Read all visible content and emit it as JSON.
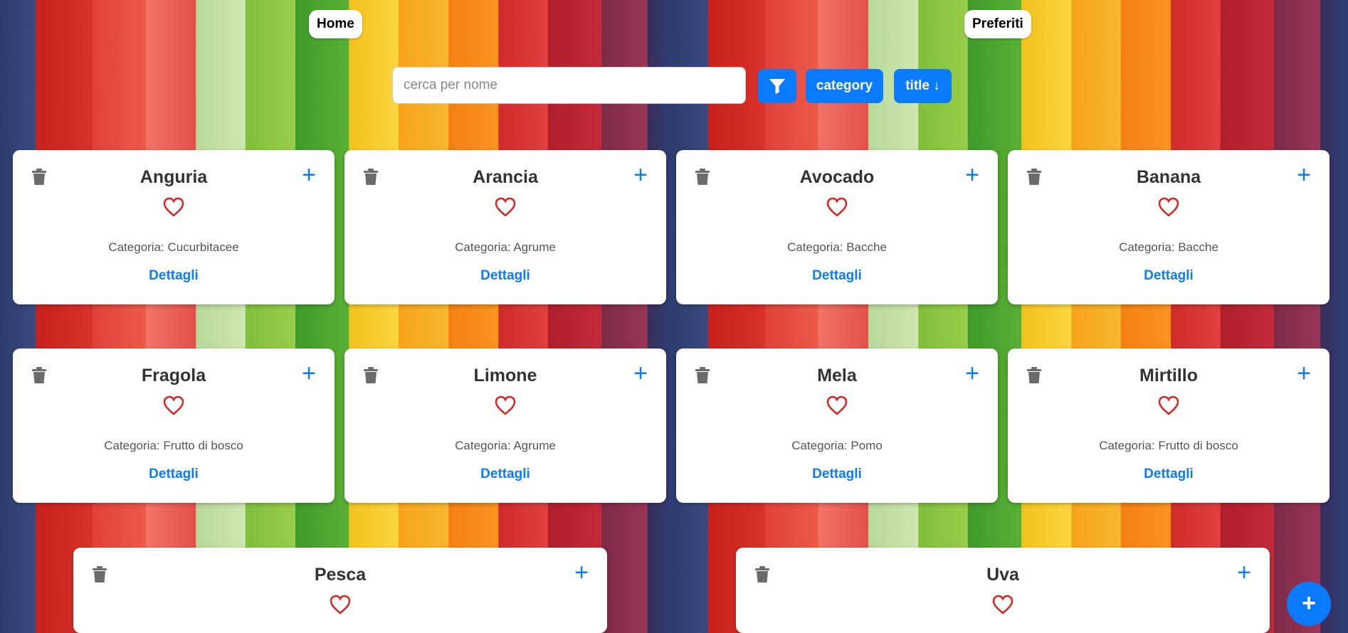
{
  "nav": {
    "home": "Home",
    "favorites": "Preferiti"
  },
  "search": {
    "placeholder": "cerca per nome",
    "value": ""
  },
  "toolbar": {
    "filter_icon": "filter-icon",
    "category_label": "category",
    "title_label": "title",
    "title_sort": "↓"
  },
  "card_labels": {
    "category_prefix": "Categoria: ",
    "details": "Dettagli"
  },
  "cards": [
    {
      "title": "Anguria",
      "category": "Categoria: Cucurbitacee"
    },
    {
      "title": "Arancia",
      "category": "Categoria: Agrume"
    },
    {
      "title": "Avocado",
      "category": "Categoria: Bacche"
    },
    {
      "title": "Banana",
      "category": "Categoria: Bacche"
    },
    {
      "title": "Fragola",
      "category": "Categoria: Frutto di bosco"
    },
    {
      "title": "Limone",
      "category": "Categoria: Agrume"
    },
    {
      "title": "Mela",
      "category": "Categoria: Pomo"
    },
    {
      "title": "Mirtillo",
      "category": "Categoria: Frutto di bosco"
    },
    {
      "title": "Pesca"
    },
    {
      "title": "Uva"
    }
  ],
  "details_label": "Dettagli",
  "fab_label": "+",
  "colors": {
    "accent": "#0a7bff",
    "heart": "#e02020",
    "trash": "#6b6b6b"
  }
}
